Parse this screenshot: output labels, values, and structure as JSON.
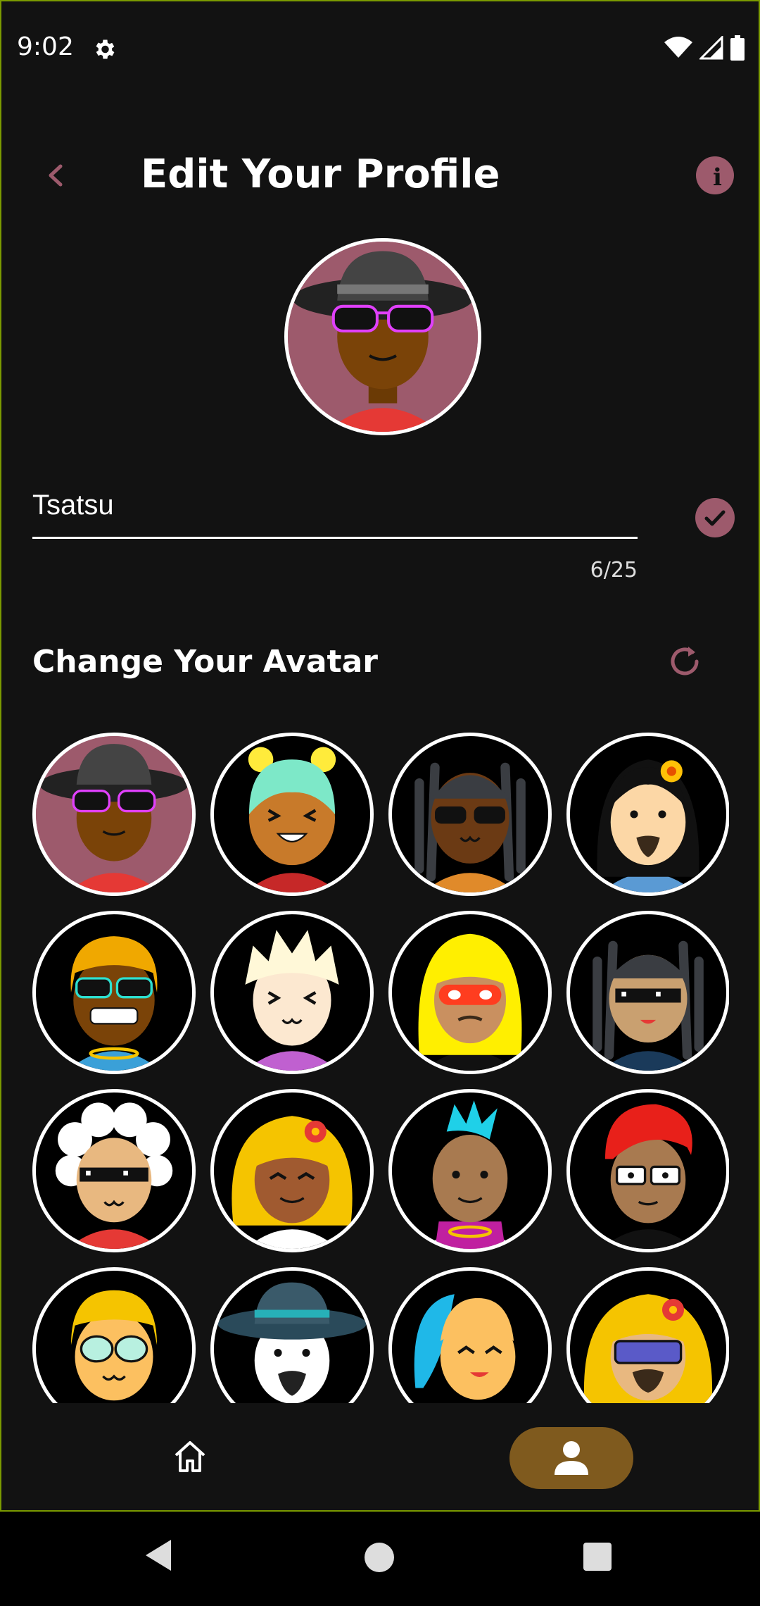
{
  "status_bar": {
    "time": "9:02",
    "icons": [
      "gear-icon",
      "wifi-icon",
      "signal-icon",
      "battery-icon"
    ]
  },
  "header": {
    "title": "Edit Your Profile",
    "back_icon": "chevron-left-icon",
    "info_icon": "info-icon"
  },
  "profile": {
    "name_value": "Tsatsu",
    "char_counter": "6/25",
    "accent_color": "#9d5a6c"
  },
  "avatar_section": {
    "title": "Change Your Avatar",
    "refresh_icon": "refresh-icon",
    "selected_index": 0,
    "avatars": [
      "hat-pink-glasses",
      "green-hair-buns",
      "dreadlocks-sunglasses",
      "flower-beard",
      "orange-hair-teal-glasses",
      "spiky-blond",
      "yellow-hair-red-mask",
      "dreadlocks-pixel-glasses",
      "white-afro-pixel-glasses",
      "curly-hair-flower",
      "cyan-mohawk",
      "red-hair-glasses",
      "yellow-hair-green-glasses",
      "teal-hat-beard",
      "blue-ponytail",
      "flower-curly-visor"
    ]
  },
  "bottom_nav": {
    "home_icon": "home-icon",
    "profile_icon": "person-icon",
    "active": "profile",
    "active_color": "#7f5a1e"
  },
  "system_nav": [
    "back-triangle-icon",
    "home-circle-icon",
    "recents-square-icon"
  ]
}
